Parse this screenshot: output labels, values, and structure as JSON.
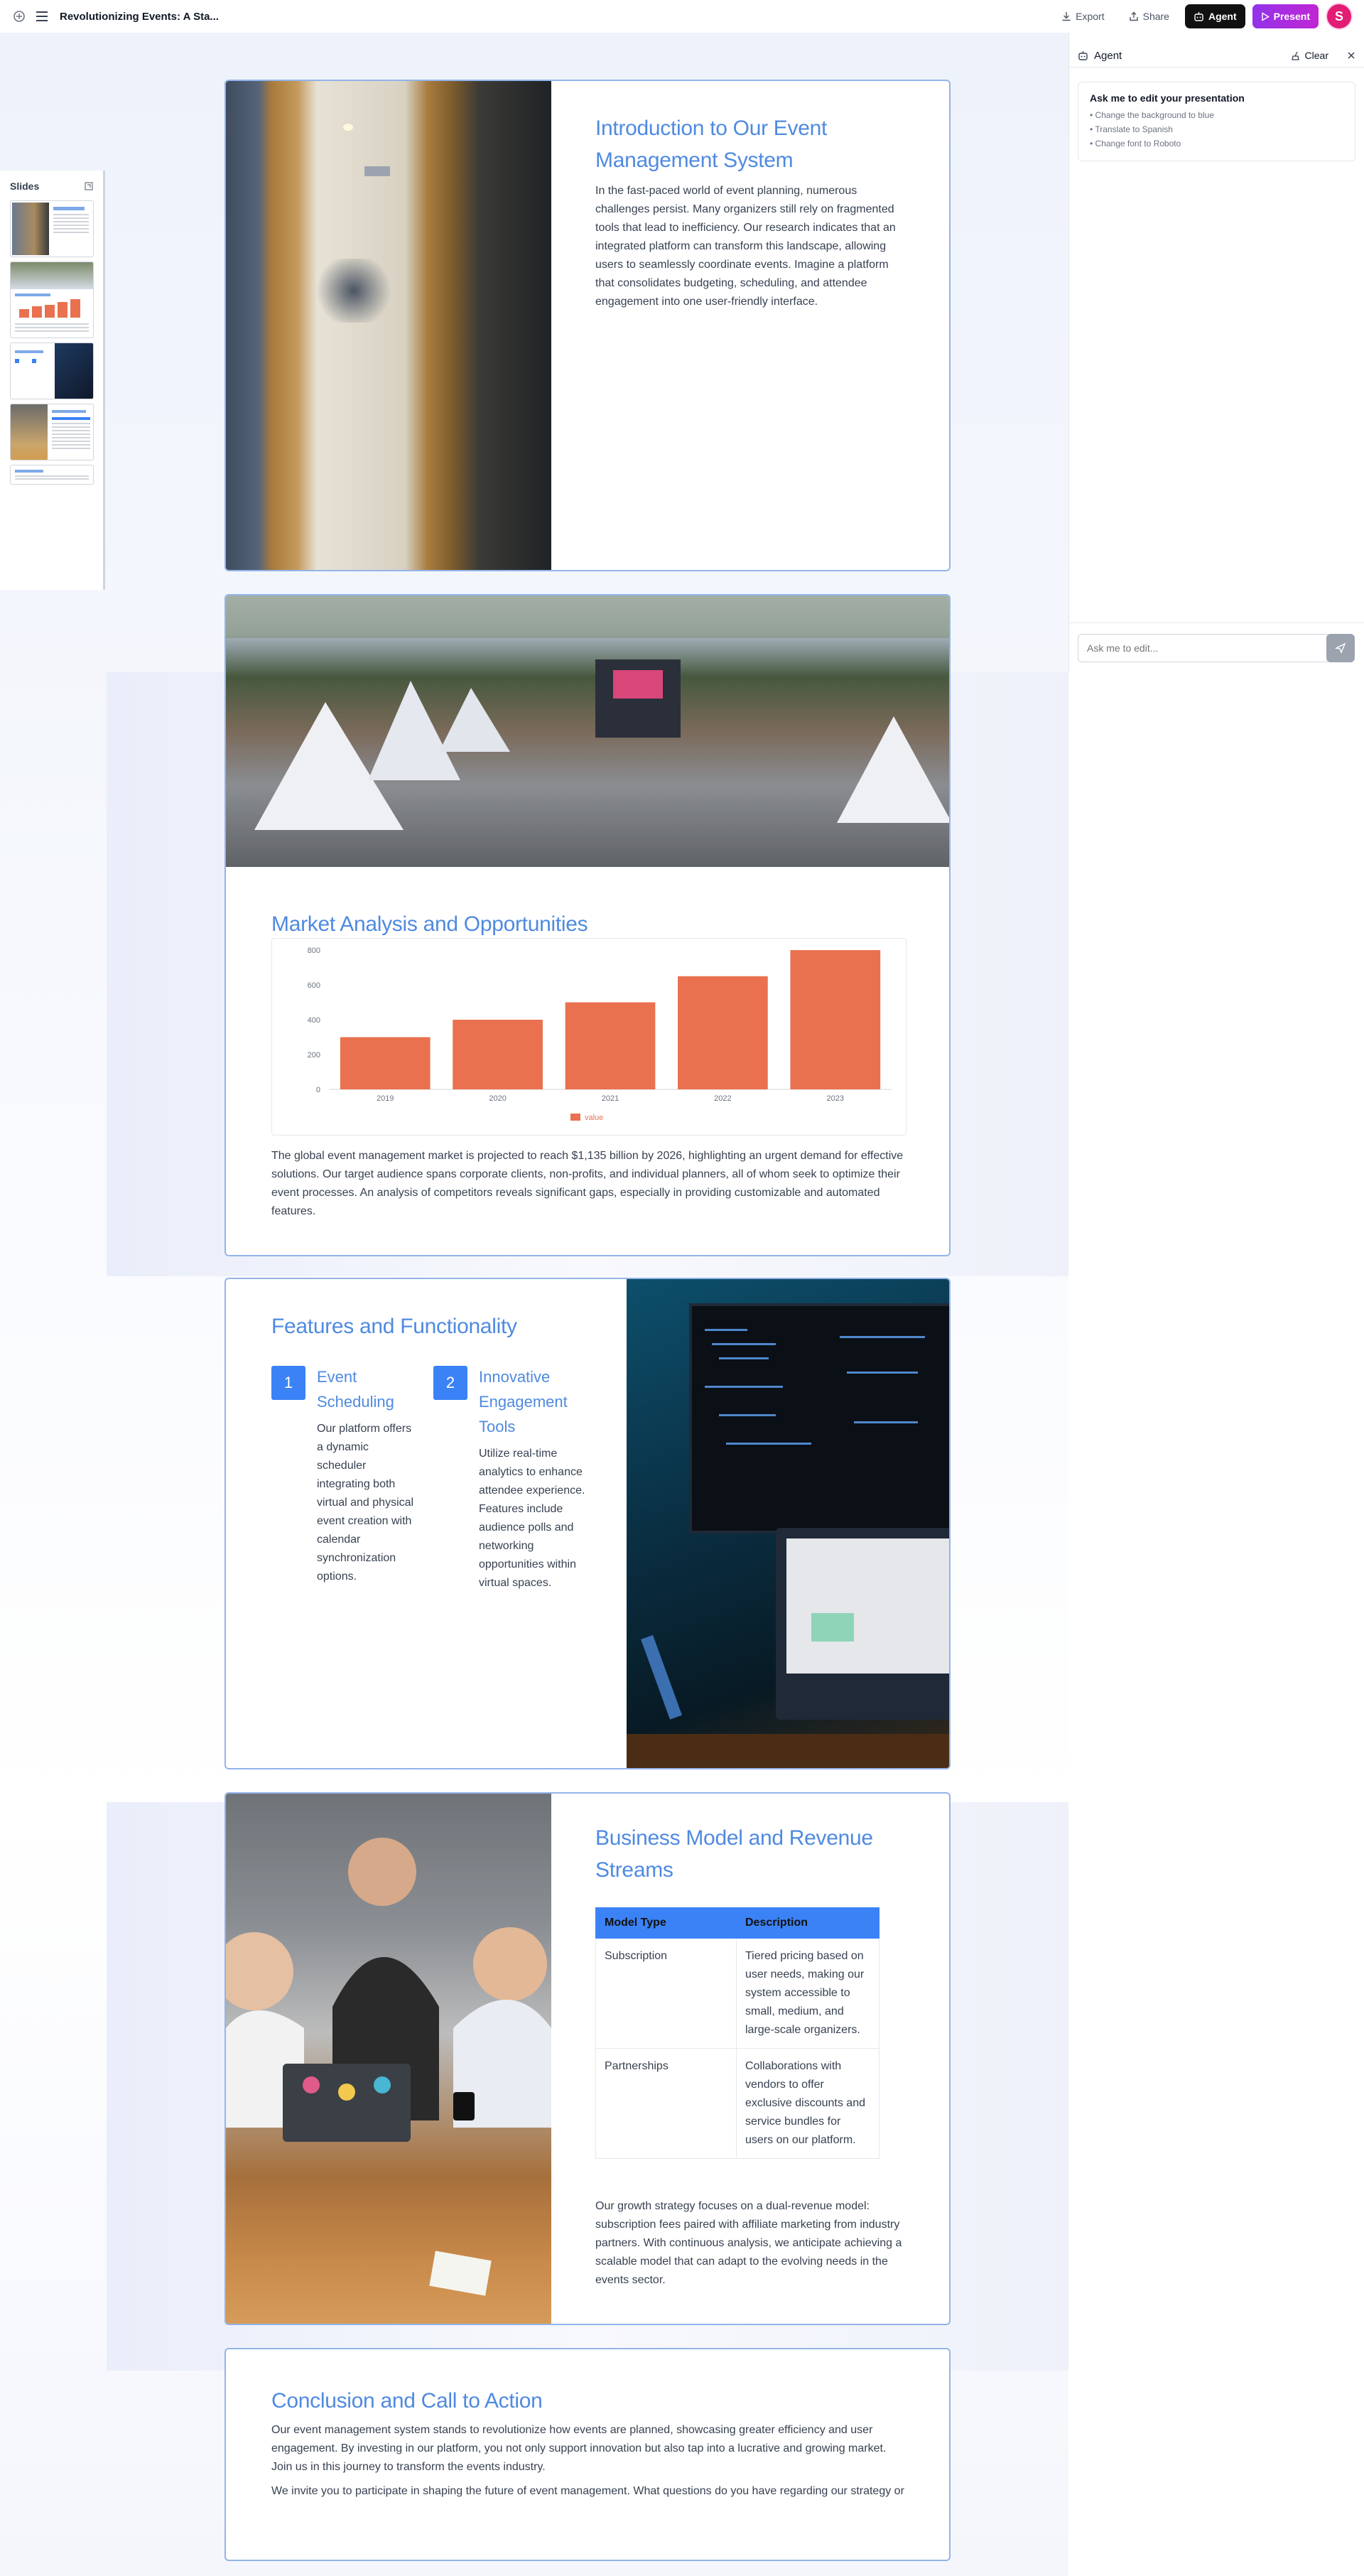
{
  "app": {
    "title": "Revolutionizing Events: A Sta...",
    "export_label": "Export",
    "share_label": "Share",
    "agent_label": "Agent",
    "present_label": "Present",
    "avatar_initial": "S"
  },
  "slides_panel": {
    "title": "Slides"
  },
  "agent": {
    "title": "Agent",
    "clear_label": "Clear",
    "card_title": "Ask me to edit your presentation",
    "suggestions": [
      "• Change the background to blue",
      "• Translate to Spanish",
      "• Change font to Roboto"
    ],
    "input_placeholder": "Ask me to edit..."
  },
  "slide1": {
    "title": "Introduction to Our Event Management System",
    "body": "In the fast-paced world of event planning, numerous challenges persist. Many organizers still rely on fragmented tools that lead to inefficiency. Our research indicates that an integrated platform can transform this landscape, allowing users to seamlessly coordinate events. Imagine a platform that consolidates budgeting, scheduling, and attendee engagement into one user-friendly interface."
  },
  "slide2": {
    "title": "Market Analysis and Opportunities",
    "body": "The global event management market is projected to reach $1,135 billion by 2026, highlighting an urgent demand for effective solutions. Our target audience spans corporate clients, non-profits, and individual planners, all of whom seek to optimize their event processes. An analysis of competitors reveals significant gaps, especially in providing customizable and automated features."
  },
  "chart_data": {
    "type": "bar",
    "categories": [
      "2019",
      "2020",
      "2021",
      "2022",
      "2023"
    ],
    "series": [
      {
        "name": "value",
        "values": [
          300,
          400,
          500,
          650,
          800
        ]
      }
    ],
    "ylim": [
      0,
      800
    ],
    "yticks": [
      "0",
      "200",
      "400",
      "600",
      "800"
    ],
    "title": "",
    "xlabel": "",
    "ylabel": "",
    "legend": "bottom",
    "color": "#e97150"
  },
  "slide3": {
    "title": "Features and Functionality",
    "features": [
      {
        "num": "1",
        "title": "Event Scheduling",
        "text": "Our platform offers a dynamic scheduler integrating both virtual and physical event creation with calendar synchronization options."
      },
      {
        "num": "2",
        "title": "Innovative Engagement Tools",
        "text": "Utilize real-time analytics to enhance attendee experience. Features include audience polls and networking opportunities within virtual spaces."
      }
    ]
  },
  "slide4": {
    "title": "Business Model and Revenue Streams",
    "table_headers": [
      "Model Type",
      "Description"
    ],
    "rows": [
      [
        "Subscription",
        "Tiered pricing based on user needs, making our system accessible to small, medium, and large-scale organizers."
      ],
      [
        "Partnerships",
        "Collaborations with vendors to offer exclusive discounts and service bundles for users on our platform."
      ]
    ],
    "body": "Our growth strategy focuses on a dual-revenue model: subscription fees paired with affiliate marketing from industry partners. With continuous analysis, we anticipate achieving a scalable model that can adapt to the evolving needs in the events sector."
  },
  "slide5": {
    "title": "Conclusion and Call to Action",
    "body1": "Our event management system stands to revolutionize how events are planned, showcasing greater efficiency and user engagement. By investing in our platform, you not only support innovation but also tap into a lucrative and growing market. Join us in this journey to transform the events industry.",
    "body2": "We invite you to participate in shaping the future of event management. What questions do you have regarding our strategy or"
  },
  "colors": {
    "accent": "#4f8ae0",
    "table_header": "#3b82f6",
    "bar": "#e97150",
    "present": "#a21caf"
  }
}
